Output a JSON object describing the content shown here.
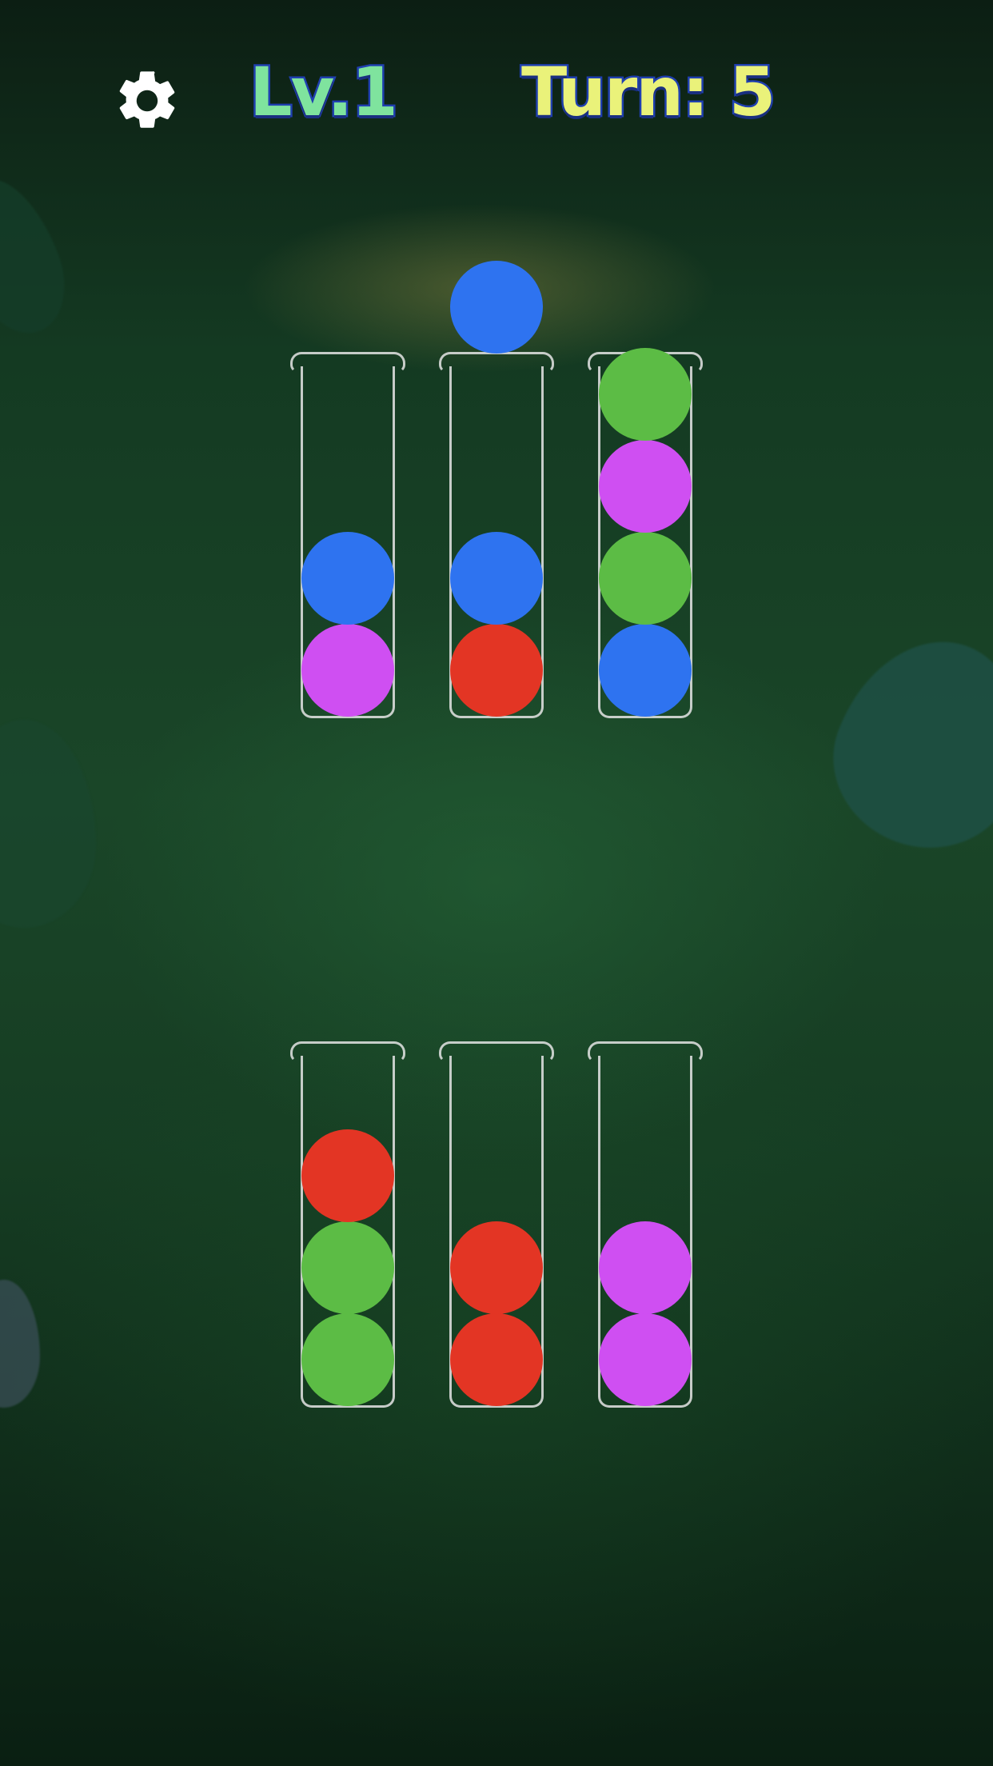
{
  "header": {
    "level_label": "Lv.1",
    "turn_label": "Turn: 5"
  },
  "icons": {
    "settings": "gear-icon"
  },
  "colors": {
    "blue": "#2e73f0",
    "purple": "#cf4ff2",
    "red": "#e33524",
    "green": "#5cbc45"
  },
  "floating_ball": {
    "color": "blue",
    "above_tube": 2
  },
  "tubes": [
    {
      "id": 1,
      "balls_bottom_to_top": [
        "purple",
        "blue"
      ]
    },
    {
      "id": 2,
      "balls_bottom_to_top": [
        "red",
        "blue"
      ]
    },
    {
      "id": 3,
      "balls_bottom_to_top": [
        "blue",
        "green",
        "purple",
        "green"
      ]
    },
    {
      "id": 4,
      "balls_bottom_to_top": [
        "green",
        "green",
        "red"
      ]
    },
    {
      "id": 5,
      "balls_bottom_to_top": [
        "red",
        "red"
      ]
    },
    {
      "id": 6,
      "balls_bottom_to_top": [
        "purple",
        "purple"
      ]
    }
  ]
}
